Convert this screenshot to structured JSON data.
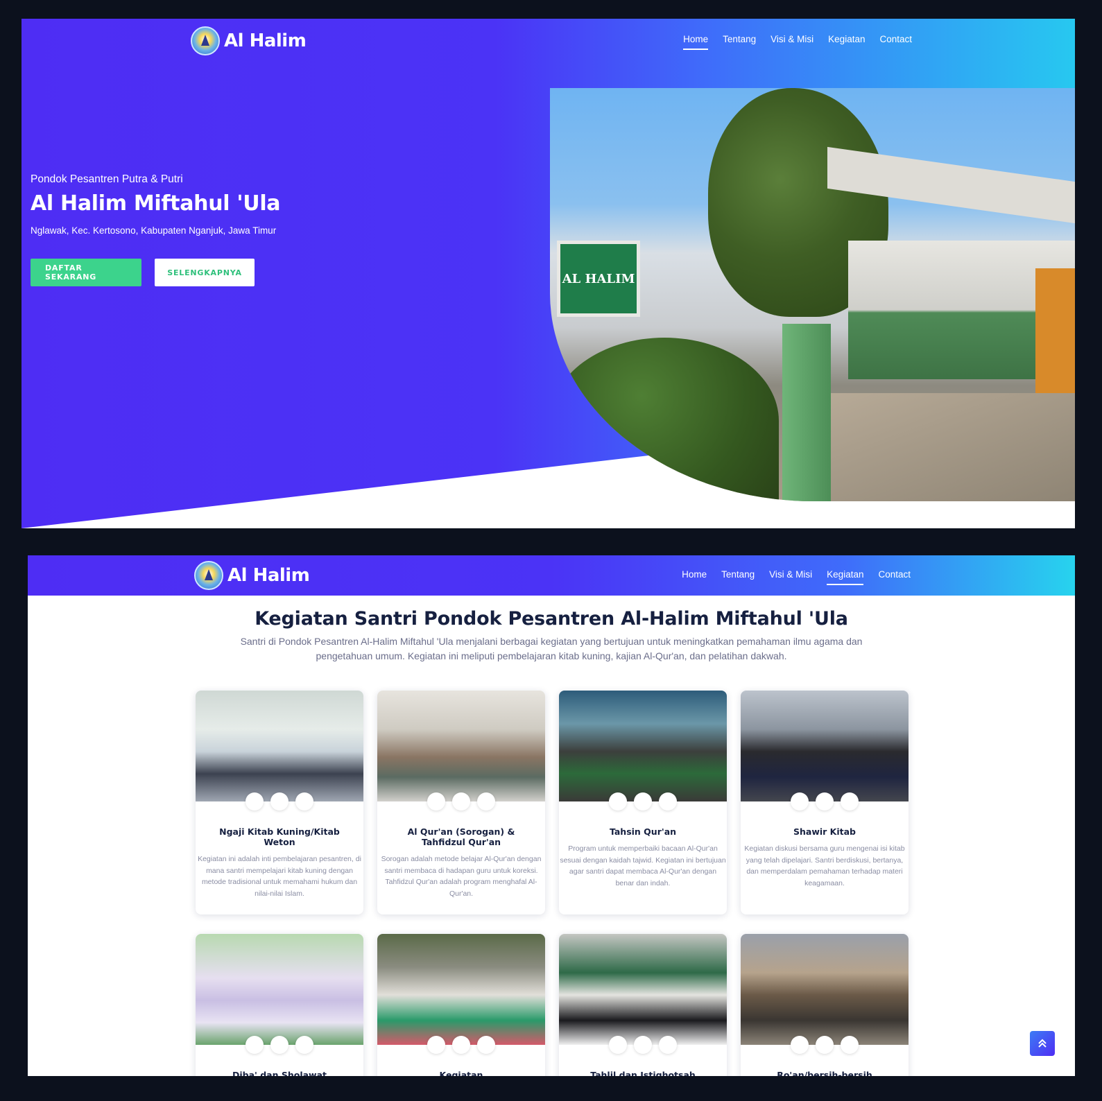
{
  "brand": {
    "name": "Al Halim"
  },
  "nav": [
    "Home",
    "Tentang",
    "Visi & Misi",
    "Kegiatan",
    "Contact"
  ],
  "hero": {
    "subtitle": "Pondok Pesantren Putra & Putri",
    "title": "Al Halim Miftahul 'Ula",
    "address": "Nglawak, Kec. Kertosono, Kabupaten Nganjuk, Jawa Timur",
    "primary_button": "DAFTAR SEKARANG",
    "secondary_button": "SELENGKAPNYA",
    "photo_sign": "AL HALIM"
  },
  "kegiatan": {
    "title": "Kegiatan Santri Pondok Pesantren Al-Halim Miftahul 'Ula",
    "description": "Santri di Pondok Pesantren Al-Halim Miftahul 'Ula menjalani berbagai kegiatan yang bertujuan untuk meningkatkan pemahaman ilmu agama dan pengetahuan umum. Kegiatan ini meliputi pembelajaran kitab kuning, kajian Al-Qur'an, dan pelatihan dakwah.",
    "cards": [
      {
        "title": "Ngaji Kitab Kuning/Kitab Weton",
        "text": "Kegiatan ini adalah inti pembelajaran pesantren, di mana santri mempelajari kitab kuning dengan metode tradisional untuk memahami hukum dan nilai-nilai Islam."
      },
      {
        "title": "Al Qur'an (Sorogan) & Tahfidzul Qur'an",
        "text": "Sorogan adalah metode belajar Al-Qur'an dengan santri membaca di hadapan guru untuk koreksi. Tahfidzul Qur'an adalah program menghafal Al-Qur'an."
      },
      {
        "title": "Tahsin Qur'an",
        "text": "Program untuk memperbaiki bacaan Al-Qur'an sesuai dengan kaidah tajwid. Kegiatan ini bertujuan agar santri dapat membaca Al-Qur'an dengan benar dan indah."
      },
      {
        "title": "Shawir Kitab",
        "text": "Kegiatan diskusi bersama guru mengenai isi kitab yang telah dipelajari. Santri berdiskusi, bertanya, dan memperdalam pemahaman terhadap materi keagamaan."
      },
      {
        "title": "Diba' dan Sholawat",
        "text": ""
      },
      {
        "title": "Kegiatan Romadhon/Pengajian Kilatan",
        "text": ""
      },
      {
        "title": "Tahlil dan Istighotsah",
        "text": ""
      },
      {
        "title": "Ro'an/bersih-bersih",
        "text": ""
      }
    ]
  },
  "scroll_top_icon": "double-chevron-up-icon"
}
